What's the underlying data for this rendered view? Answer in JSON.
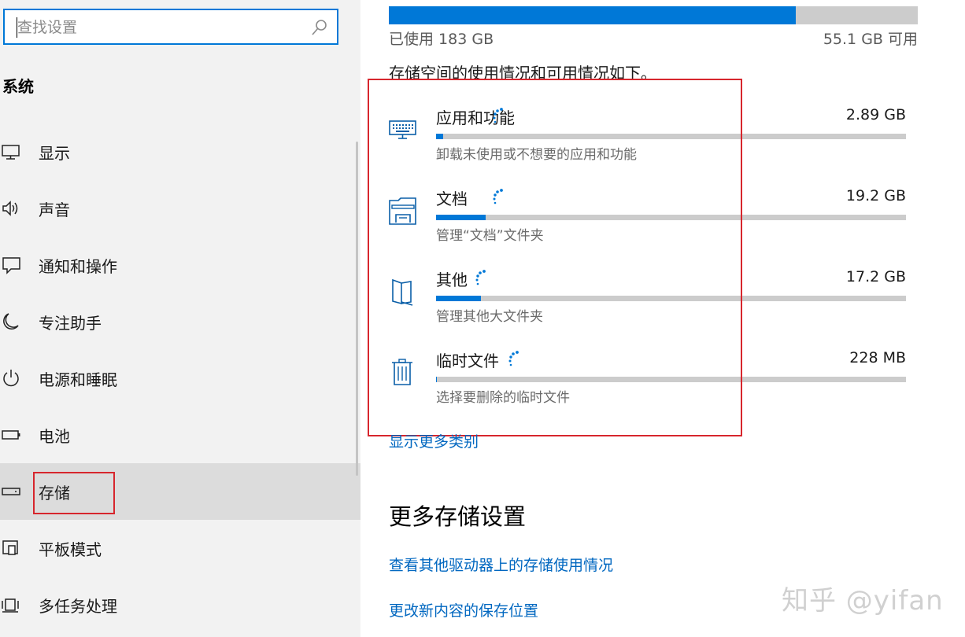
{
  "sidebar": {
    "search_placeholder": "查找设置",
    "section_title": "系统",
    "items": [
      {
        "label": "显示",
        "icon": "monitor-icon"
      },
      {
        "label": "声音",
        "icon": "speaker-icon"
      },
      {
        "label": "通知和操作",
        "icon": "message-icon"
      },
      {
        "label": "专注助手",
        "icon": "moon-icon"
      },
      {
        "label": "电源和睡眠",
        "icon": "power-icon"
      },
      {
        "label": "电池",
        "icon": "battery-icon"
      },
      {
        "label": "存储",
        "icon": "drive-icon",
        "selected": true
      },
      {
        "label": "平板模式",
        "icon": "tablet-mode-icon"
      },
      {
        "label": "多任务处理",
        "icon": "multitask-icon"
      }
    ]
  },
  "storage": {
    "used_label": "已使用 183 GB",
    "free_label": "55.1 GB 可用",
    "used_fraction": 0.77,
    "intro": "存储空间的使用情况和可用情况如下。",
    "categories": [
      {
        "name": "应用和功能",
        "size": "2.89 GB",
        "desc": "卸载未使用或不想要的应用和功能",
        "fraction": 0.015,
        "icon": "keyboard-icon"
      },
      {
        "name": "文档",
        "size": "19.2 GB",
        "desc": "管理“文档”文件夹",
        "fraction": 0.105,
        "icon": "documents-folder-icon"
      },
      {
        "name": "其他",
        "size": "17.2 GB",
        "desc": "管理其他大文件夹",
        "fraction": 0.095,
        "icon": "other-files-icon"
      },
      {
        "name": "临时文件",
        "size": "228 MB",
        "desc": "选择要删除的临时文件",
        "fraction": 0.002,
        "icon": "trash-icon"
      }
    ],
    "show_more": "显示更多类别",
    "more_title": "更多存储设置",
    "link_other_drives": "查看其他驱动器上的存储使用情况",
    "link_save_location": "更改新内容的保存位置"
  },
  "watermark": "知乎 @yifan",
  "colors": {
    "accent": "#0078d7",
    "annotation": "#d7262d",
    "link": "#0067c0"
  }
}
